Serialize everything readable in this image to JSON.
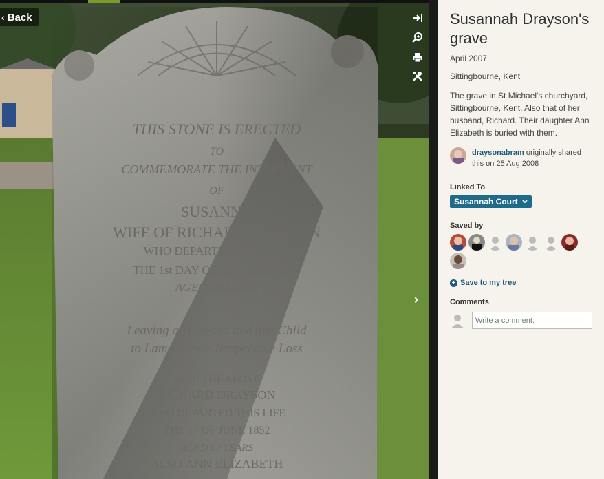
{
  "viewer": {
    "back_label": "Back",
    "tools": [
      "collapse-panel-icon",
      "zoom-icon",
      "print-icon",
      "tools-icon"
    ],
    "photo_inscription": {
      "line1": "THIS STONE IS ERECTED",
      "line2": "TO",
      "line3": "COMMEMORATE THE INTERMENT",
      "line4": "OF",
      "line5": "SUSANNA",
      "line6": "WIFE OF RICHARD DRAYSON",
      "line7": "WHO DEPARTED THIS LIFE",
      "line8": "THE 1st DAY OF OCTOBER 1823",
      "line9": "AGED 39 YEARS",
      "line10": "Leaving a Husband and one Child",
      "line11": "to Lament their Irreparable Loss",
      "line12": "ALSO THE ABOVE",
      "line13": "RICHARD DRAYSON",
      "line14": "WHO DEPARTED THIS LIFE",
      "line15": "THE 17 OF JUNE 1852",
      "line16": "AGED 67 YEARS",
      "line17": "ALSO ANN ELIZABETH"
    }
  },
  "panel": {
    "title": "Susannah Drayson's grave",
    "date": "April 2007",
    "place": "Sittingbourne, Kent",
    "description": "The grave in St Michael's churchyard, Sittingbourne, Kent. Also that of her husband, Richard. Their daughter Ann Elizabeth is buried with them.",
    "sharer_name": "draysonabram",
    "sharer_suffix": " originally shared this on 25 Aug 2008",
    "linked_to_label": "Linked To",
    "linked_person": "Susannah Court",
    "saved_by_label": "Saved by",
    "saved_avatars": [
      "photo",
      "photo",
      "silhouette",
      "photo",
      "silhouette",
      "silhouette",
      "photo",
      "photo"
    ],
    "save_to_tree_label": "Save to my tree",
    "comments_label": "Comments",
    "comment_placeholder": "Write a comment."
  },
  "colors": {
    "panel_bg": "#f6f3ec",
    "link": "#1a5a7a",
    "pill": "#1e6b8a"
  }
}
